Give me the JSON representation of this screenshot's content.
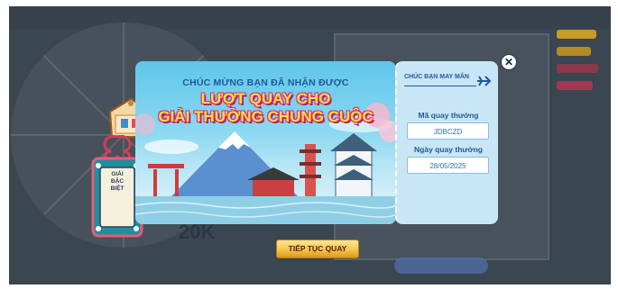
{
  "popup": {
    "headline_line1": "CHÚC MỪNG BẠN ĐÃ NHẬN ĐƯỢC",
    "headline_line2": "LƯỢT QUAY CHO",
    "headline_line3": "GIẢI THƯỞNG CHUNG CUỘC",
    "ticket_stub_title": "CHÚC BẠN MAY MẮN",
    "spin_code_label": "Mã quay thưởng",
    "spin_code_value": "JDBCZD",
    "spin_date_label": "Ngày quay thưởng",
    "spin_date_value": "28/05/2025",
    "close_icon": "close-icon",
    "continue_label": "TIẾP TỤC QUAY"
  },
  "charm": {
    "text_line1": "GIẢI",
    "text_line2": "ĐẶC",
    "text_line3": "BIỆT"
  },
  "background": {
    "wheel_prize_text": "20K"
  },
  "colors": {
    "overlay": "#3a4650",
    "accent_blue": "#1f5a9a",
    "title_yellow": "#f7e23e",
    "title_pink": "#e3247e",
    "button_gold": "#f3c64a"
  }
}
